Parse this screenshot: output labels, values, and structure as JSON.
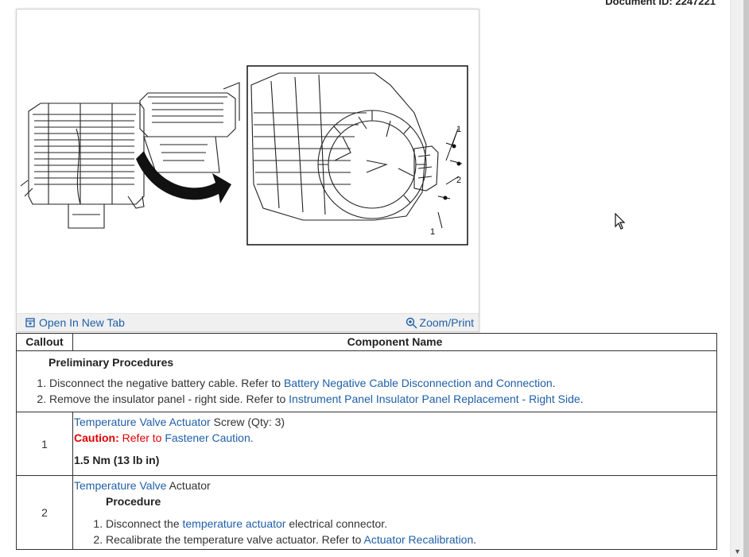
{
  "document": {
    "id_label": "Document ID: 2247221"
  },
  "figure": {
    "callout_labels": [
      "1",
      "2",
      "1"
    ],
    "open_tab_label": "Open In New Tab",
    "zoom_print_label": "Zoom/Print"
  },
  "table": {
    "headers": {
      "callout": "Callout",
      "component": "Component Name"
    },
    "preliminary": {
      "title": "Preliminary Procedures",
      "steps": [
        {
          "text": "Disconnect the negative battery cable. Refer to ",
          "link": "Battery Negative Cable Disconnection and Connection",
          "after": "."
        },
        {
          "text": "Remove the insulator panel - right side. Refer to ",
          "link": "Instrument Panel Insulator Panel Replacement - Right Side",
          "after": "."
        }
      ]
    },
    "rows": [
      {
        "callout": "1",
        "name_link": "Temperature Valve Actuator",
        "name_rest": " Screw (Qty: 3)",
        "caution_label": "Caution:",
        "caution_text": " Refer to ",
        "caution_link": "Fastener Caution",
        "caution_after": ".",
        "torque": "1.5 Nm (13 lb in)"
      },
      {
        "callout": "2",
        "name_link": "Temperature Valve",
        "name_rest": " Actuator",
        "procedure_title": "Procedure",
        "steps": [
          {
            "text": "Disconnect the ",
            "link": "temperature actuator",
            "after": " electrical connector."
          },
          {
            "text": "Recalibrate the temperature valve actuator. Refer to ",
            "link": "Actuator Recalibration",
            "after": "."
          }
        ]
      }
    ]
  },
  "colors": {
    "link": "#1f5fa8",
    "caution": "#e00000"
  }
}
